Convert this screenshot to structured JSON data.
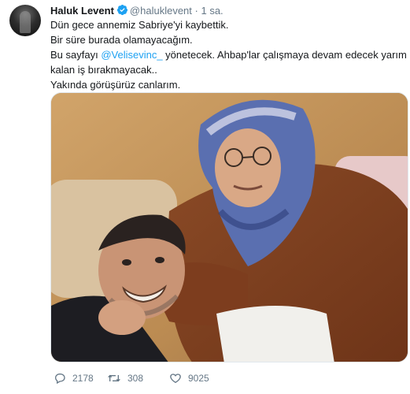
{
  "author": {
    "name": "Haluk Levent",
    "handle": "@haluklevent",
    "separator": "·",
    "time": "1 sa."
  },
  "tweet": {
    "line1": "Dün gece annemiz Sabriye'yi kaybettik.",
    "line2": "Bir süre burada olamayacağım.",
    "line3_prefix": "Bu sayfayı ",
    "line3_mention": "@Velisevinc_",
    "line3_suffix": " yönetecek. Ahbap'lar çalışmaya devam edecek yarım",
    "line4": "kalan iş bırakmayacak..",
    "line5": "Yakında görüşürüz canlarım."
  },
  "stats": {
    "replies": "2178",
    "retweets": "308",
    "likes": "9025"
  },
  "icons": {
    "verified": "verified-badge-icon",
    "reply": "reply-icon",
    "retweet": "retweet-icon",
    "like": "heart-icon"
  },
  "colors": {
    "link": "#1da1f2",
    "muted": "#657786",
    "verified": "#1da1f2"
  }
}
